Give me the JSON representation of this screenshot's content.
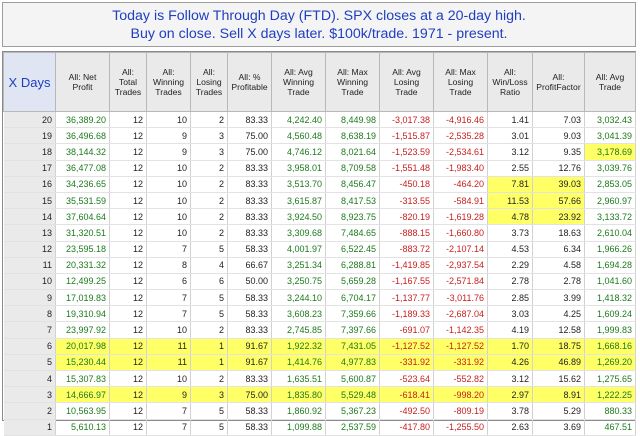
{
  "header": {
    "line1": "Today is  Follow Through Day (FTD). SPX closes at a 20-day high.",
    "line2": "Buy on close. Sell X days later. $100k/trade. 1971 - present."
  },
  "table": {
    "columns": [
      "X Days",
      "All: Net Profit",
      "All: Total Trades",
      "All: Winning Trades",
      "All: Losing Trades",
      "All: % Profitable",
      "All: Avg Winning Trade",
      "All: Max Winning Trade",
      "All: Avg Losing Trade",
      "All: Max Losing Trade",
      "All: Win/Loss Ratio",
      "All: ProfitFactor",
      "All: Avg Trade"
    ],
    "highlight_color": "#ffff66",
    "rows": [
      {
        "cells": [
          "20",
          "36,389.20",
          "12",
          "10",
          "2",
          "83.33",
          "4,242.40",
          "8,449.98",
          "-3,017.38",
          "-4,916.46",
          "1.41",
          "7.03",
          "3,032.43"
        ],
        "row_highlight": false,
        "highlight_cols": []
      },
      {
        "cells": [
          "19",
          "36,496.68",
          "12",
          "9",
          "3",
          "75.00",
          "4,560.48",
          "8,638.19",
          "-1,515.87",
          "-2,535.28",
          "3.01",
          "9.03",
          "3,041.39"
        ],
        "row_highlight": false,
        "highlight_cols": []
      },
      {
        "cells": [
          "18",
          "38,144.32",
          "12",
          "9",
          "3",
          "75.00",
          "4,746.12",
          "8,021.64",
          "-1,523.59",
          "-2,534.61",
          "3.12",
          "9.35",
          "3,178.69"
        ],
        "row_highlight": false,
        "highlight_cols": [
          12
        ]
      },
      {
        "cells": [
          "17",
          "36,477.08",
          "12",
          "10",
          "2",
          "83.33",
          "3,958.01",
          "8,709.58",
          "-1,551.48",
          "-1,983.40",
          "2.55",
          "12.76",
          "3,039.76"
        ],
        "row_highlight": false,
        "highlight_cols": []
      },
      {
        "cells": [
          "16",
          "34,236.65",
          "12",
          "10",
          "2",
          "83.33",
          "3,513.70",
          "8,456.47",
          "-450.18",
          "-464.20",
          "7.81",
          "39.03",
          "2,853.05"
        ],
        "row_highlight": false,
        "highlight_cols": [
          10,
          11
        ]
      },
      {
        "cells": [
          "15",
          "35,531.59",
          "12",
          "10",
          "2",
          "83.33",
          "3,615.87",
          "8,417.53",
          "-313.55",
          "-584.91",
          "11.53",
          "57.66",
          "2,960.97"
        ],
        "row_highlight": false,
        "highlight_cols": [
          10,
          11
        ]
      },
      {
        "cells": [
          "14",
          "37,604.64",
          "12",
          "10",
          "2",
          "83.33",
          "3,924.50",
          "8,923.75",
          "-820.19",
          "-1,619.28",
          "4.78",
          "23.92",
          "3,133.72"
        ],
        "row_highlight": false,
        "highlight_cols": [
          10,
          11
        ]
      },
      {
        "cells": [
          "13",
          "31,320.51",
          "12",
          "10",
          "2",
          "83.33",
          "3,309.68",
          "7,484.65",
          "-888.15",
          "-1,660.80",
          "3.73",
          "18.63",
          "2,610.04"
        ],
        "row_highlight": false,
        "highlight_cols": []
      },
      {
        "cells": [
          "12",
          "23,595.18",
          "12",
          "7",
          "5",
          "58.33",
          "4,001.97",
          "6,522.45",
          "-883.72",
          "-2,107.14",
          "4.53",
          "6.34",
          "1,966.26"
        ],
        "row_highlight": false,
        "highlight_cols": []
      },
      {
        "cells": [
          "11",
          "20,331.32",
          "12",
          "8",
          "4",
          "66.67",
          "3,251.34",
          "6,288.81",
          "-1,419.85",
          "-2,937.54",
          "2.29",
          "4.58",
          "1,694.28"
        ],
        "row_highlight": false,
        "highlight_cols": []
      },
      {
        "cells": [
          "10",
          "12,499.25",
          "12",
          "6",
          "6",
          "50.00",
          "3,250.75",
          "5,659.28",
          "-1,167.55",
          "-2,571.84",
          "2.78",
          "2.78",
          "1,041.60"
        ],
        "row_highlight": false,
        "highlight_cols": []
      },
      {
        "cells": [
          "9",
          "17,019.83",
          "12",
          "7",
          "5",
          "58.33",
          "3,244.10",
          "6,704.17",
          "-1,137.77",
          "-3,011.76",
          "2.85",
          "3.99",
          "1,418.32"
        ],
        "row_highlight": false,
        "highlight_cols": []
      },
      {
        "cells": [
          "8",
          "19,310.94",
          "12",
          "7",
          "5",
          "58.33",
          "3,608.23",
          "7,359.66",
          "-1,189.33",
          "-2,687.04",
          "3.03",
          "4.25",
          "1,609.24"
        ],
        "row_highlight": false,
        "highlight_cols": []
      },
      {
        "cells": [
          "7",
          "23,997.92",
          "12",
          "10",
          "2",
          "83.33",
          "2,745.85",
          "7,397.66",
          "-691.07",
          "-1,142.35",
          "4.19",
          "12.58",
          "1,999.83"
        ],
        "row_highlight": false,
        "highlight_cols": []
      },
      {
        "cells": [
          "6",
          "20,017.98",
          "12",
          "11",
          "1",
          "91.67",
          "1,922.32",
          "7,431.05",
          "-1,127.52",
          "-1,127.52",
          "1.70",
          "18.75",
          "1,668.16"
        ],
        "row_highlight": true,
        "highlight_cols": []
      },
      {
        "cells": [
          "5",
          "15,230.44",
          "12",
          "11",
          "1",
          "91.67",
          "1,414.76",
          "4,977.83",
          "-331.92",
          "-331.92",
          "4.26",
          "46.89",
          "1,269.20"
        ],
        "row_highlight": true,
        "highlight_cols": []
      },
      {
        "cells": [
          "4",
          "15,307.83",
          "12",
          "10",
          "2",
          "83.33",
          "1,635.51",
          "5,600.87",
          "-523.64",
          "-552.82",
          "3.12",
          "15.62",
          "1,275.65"
        ],
        "row_highlight": false,
        "highlight_cols": []
      },
      {
        "cells": [
          "3",
          "14,666.97",
          "12",
          "9",
          "3",
          "75.00",
          "1,835.80",
          "5,529.48",
          "-618.41",
          "-998.20",
          "2.97",
          "8.91",
          "1,222.25"
        ],
        "row_highlight": true,
        "highlight_cols": []
      },
      {
        "cells": [
          "2",
          "10,563.95",
          "12",
          "7",
          "5",
          "58.33",
          "1,860.92",
          "5,367.23",
          "-492.50",
          "-809.19",
          "3.78",
          "5.29",
          "880.33"
        ],
        "row_highlight": false,
        "highlight_cols": []
      },
      {
        "cells": [
          "1",
          "5,610.13",
          "12",
          "7",
          "5",
          "58.33",
          "1,099.88",
          "2,537.59",
          "-417.80",
          "-1,255.50",
          "2.63",
          "3.69",
          "467.51"
        ],
        "row_highlight": false,
        "highlight_cols": []
      }
    ]
  }
}
